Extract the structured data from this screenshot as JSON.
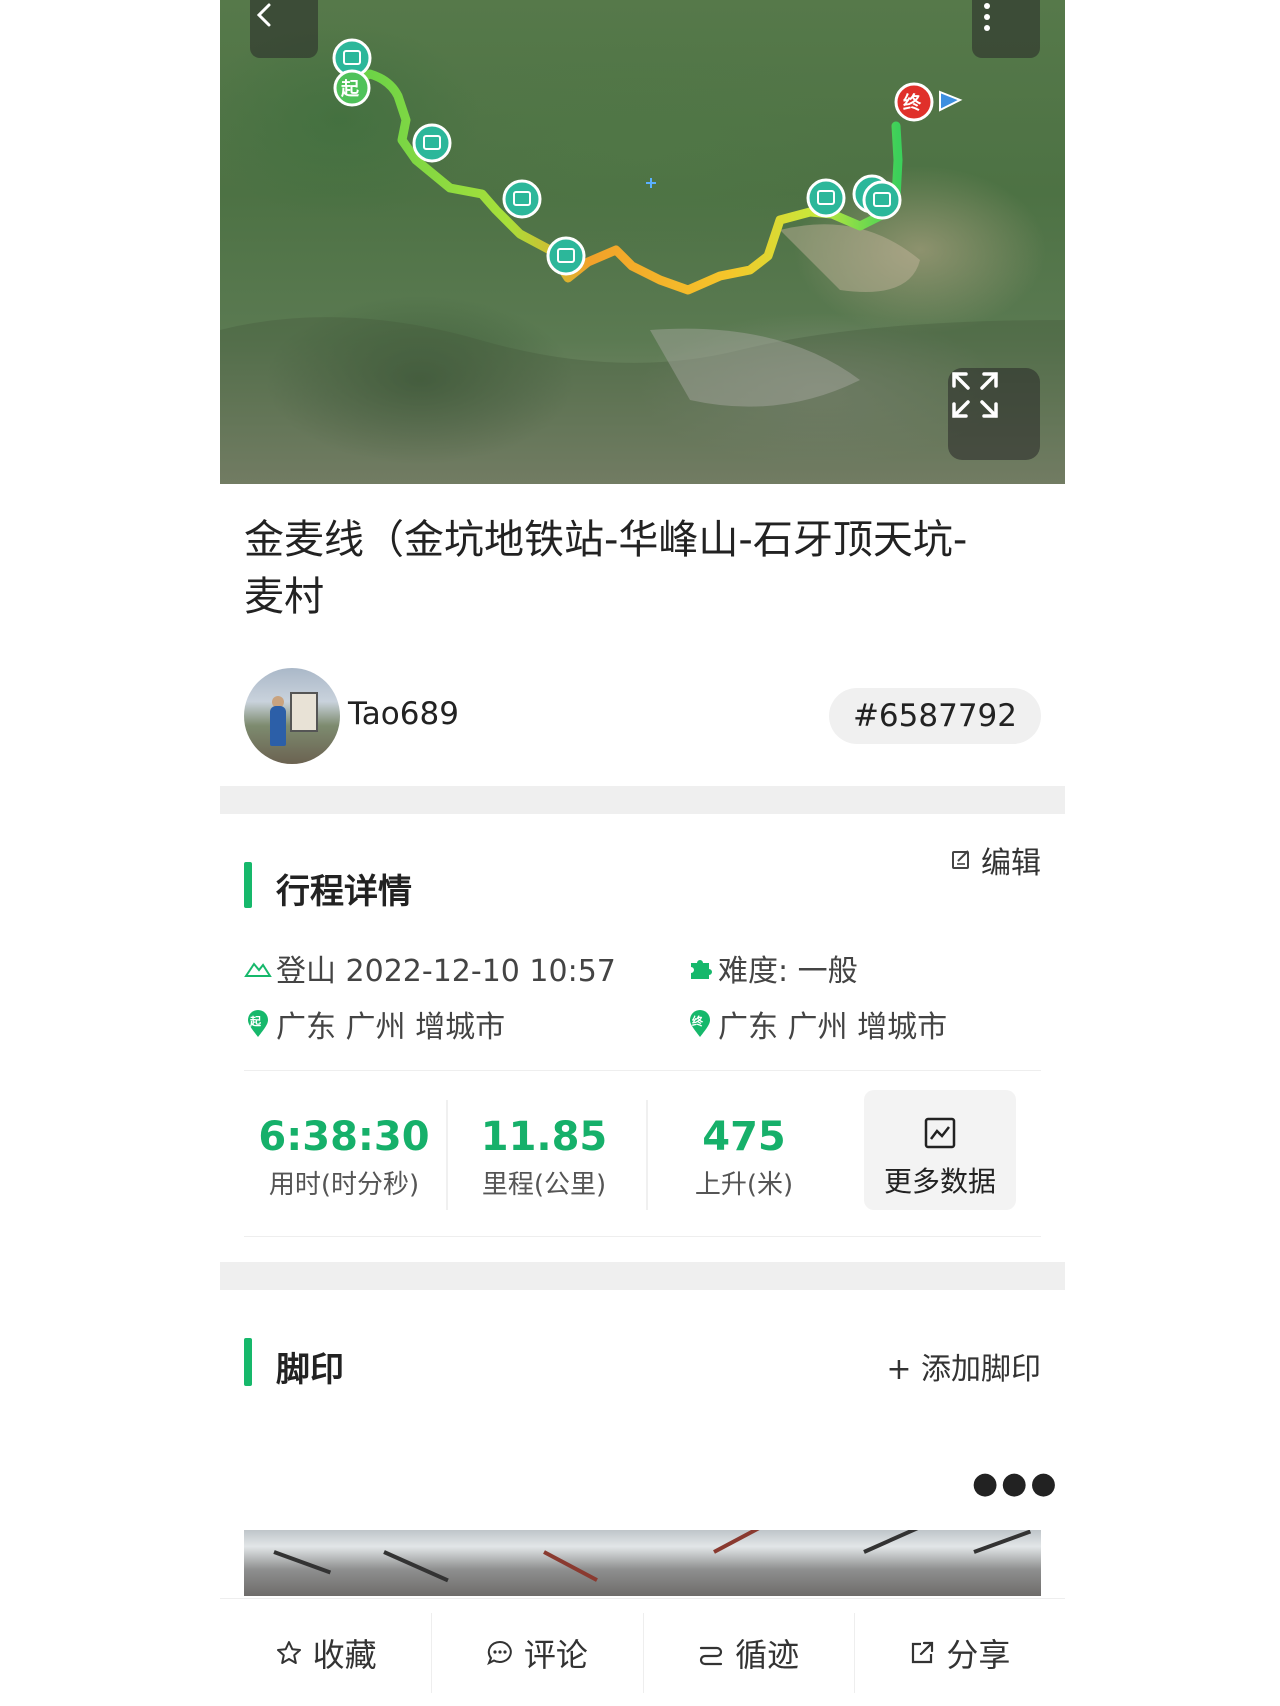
{
  "route": {
    "title": "金麦线（金坑地铁站-华峰山-石牙顶天坑-麦村",
    "start_marker": "起",
    "end_marker": "终"
  },
  "author": {
    "name": "Tao689",
    "track_id": "#6587792"
  },
  "trip_details": {
    "section_title": "行程详情",
    "edit_label": "编辑",
    "activity": "登山 2022-12-10 10:57",
    "difficulty": "难度:  一般",
    "start_location": "广东 广州 增城市",
    "end_location": "广东 广州 增城市",
    "start_icon_text": "起",
    "end_icon_text": "终"
  },
  "stats": [
    {
      "value": "6:38:30",
      "label": "用时(时分秒)"
    },
    {
      "value": "11.85",
      "label": "里程(公里)"
    },
    {
      "value": "475",
      "label": "上升(米)"
    }
  ],
  "more_data_label": "更多数据",
  "footprint": {
    "section_title": "脚印",
    "add_label": "+ 添加脚印"
  },
  "bottom_bar": [
    {
      "label": "收藏",
      "icon": "star-icon"
    },
    {
      "label": "评论",
      "icon": "comment-icon"
    },
    {
      "label": "循迹",
      "icon": "follow-track-icon"
    },
    {
      "label": "分享",
      "icon": "share-icon"
    }
  ],
  "colors": {
    "accent": "#16b86b",
    "stat_value": "#16b06a"
  }
}
